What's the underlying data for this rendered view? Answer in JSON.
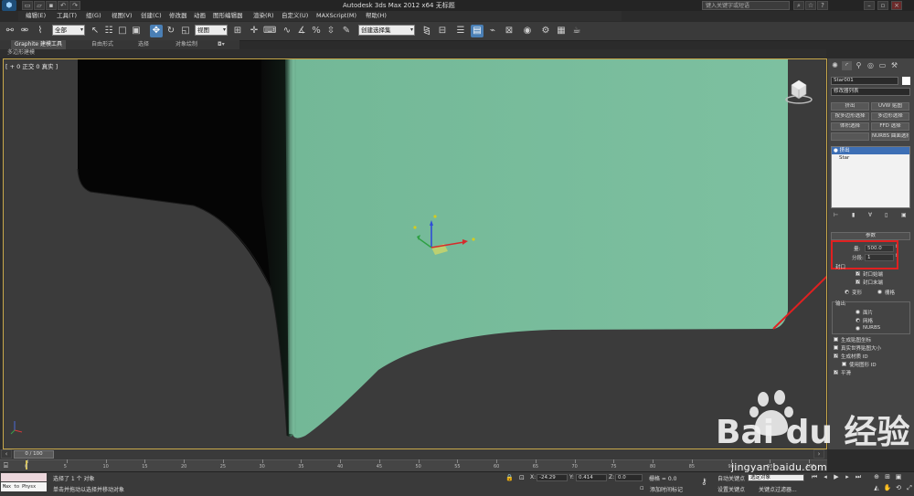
{
  "window": {
    "title": "Autodesk 3ds Max  2012 x64      无标题",
    "search_placeholder": "键入关键字或短语"
  },
  "menu": [
    "编辑(E)",
    "工具(T)",
    "组(G)",
    "视图(V)",
    "创建(C)",
    "修改器",
    "动画",
    "图形编辑器",
    "渲染(R)",
    "自定义(U)",
    "MAXScript(M)",
    "帮助(H)"
  ],
  "toolbar": {
    "filter_value": "全部",
    "coord_value": "视图",
    "selset_value": "创建选择集"
  },
  "ribbon": {
    "tabs": [
      "Graphite 建模工具",
      "自由形式",
      "选择",
      "对象绘制"
    ],
    "sub": "多边形建模"
  },
  "viewport": {
    "label": "[ + 0 正交 0 真实 ]"
  },
  "command_panel": {
    "object_name": "Star001",
    "modifier_list": "修改器列表",
    "buttons": [
      "挤出",
      "UVW 贴图",
      "FFD 选择",
      "多边形选择",
      "体积选择",
      "FFD 选择",
      "",
      "NURBS 曲面选择"
    ],
    "button_row1": [
      "挤出",
      "UVW 贴图"
    ],
    "button_row2": [
      "按多边形选择",
      "多边形选择"
    ],
    "button_row3": [
      "体积选择",
      "FFD 选择"
    ],
    "button_row4": [
      "",
      "NURBS 曲面选择"
    ],
    "stack": [
      "挤出",
      "Star"
    ],
    "params_title": "参数",
    "amount_label": "量:",
    "amount_value": "500.0",
    "segments_label": "分段:",
    "segments_value": "1",
    "capping_title": "封口",
    "cap_start": "封口始端",
    "cap_end": "封口末端",
    "morph": "变形",
    "grid": "栅格",
    "output_title": "输出",
    "out_patch": "面片",
    "out_mesh": "网格",
    "out_nurbs": "NURBS",
    "gen_map": "生成贴图坐标",
    "real_world": "真实世界贴图大小",
    "gen_mat": "生成材质 ID",
    "use_shape": "使用图形 ID",
    "smooth": "平滑"
  },
  "timeline": {
    "frame_label": "0 / 100",
    "ticks": [
      0,
      5,
      10,
      15,
      20,
      25,
      30,
      35,
      40,
      45,
      50,
      55,
      60,
      65,
      70,
      75,
      80,
      85,
      90,
      95,
      100
    ]
  },
  "status": {
    "script_box": "Max to Physx",
    "selected": "选择了 1 个 对象",
    "prompt": "单击并拖动以选择并移动对象",
    "x_label": "X:",
    "x_value": "-24.29",
    "y_label": "Y:",
    "y_value": "0.414",
    "z_label": "Z:",
    "z_value": "0.0",
    "grid_label": "栅格 = 0.0",
    "add_time_tag": "添加时间标记",
    "auto_key": "自动关键点",
    "set_key": "设置关键点",
    "selected_obj": "选定对象",
    "key_filter": "关键点过滤器..."
  },
  "watermark": {
    "brand": "Bai du 经验",
    "url": "jingyan.baidu.com"
  },
  "colors": {
    "extrude_surface": "#7abf9e",
    "highlight_red": "#e02020",
    "viewport_bg": "#3b3b3b"
  }
}
